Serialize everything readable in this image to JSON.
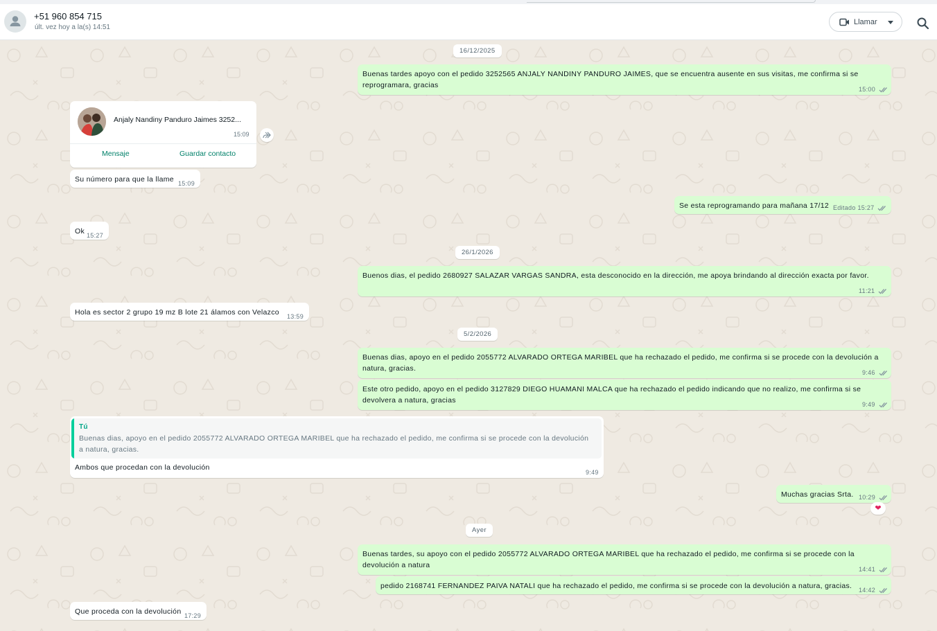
{
  "header": {
    "contact_name": "+51 960 854 715",
    "last_seen": "últ. vez hoy a la(s) 14:51",
    "call_label": "Llamar",
    "icons": [
      "person-icon",
      "video-icon",
      "chevron-down-icon",
      "search-icon"
    ]
  },
  "dates": {
    "d1": "16/12/2025",
    "d2": "26/1/2026",
    "d3": "5/2/2026",
    "d4": "Ayer"
  },
  "messages": {
    "m1": {
      "text": "Buenas tardes apoyo con el pedido 3252565 ANJALY NANDINY PANDURO JAIMES, que se encuentra ausente en sus visitas, me confirma si se reprogramara, gracias",
      "time": "15:00"
    },
    "contact_card": {
      "name": "Anjaly Nandiny Panduro Jaimes 3252...",
      "time": "15:09",
      "btn_message": "Mensaje",
      "btn_save": "Guardar contacto"
    },
    "m2": {
      "text": "Su número para que la llame",
      "time": "15:09"
    },
    "m3": {
      "text": "Se esta reprogramando para mañana 17/12",
      "edited": "Editado",
      "time": "15:27"
    },
    "m4": {
      "text": "Ok",
      "time": "15:27"
    },
    "m5": {
      "text": "Buenos dias, el pedido 2680927 SALAZAR VARGAS SANDRA, esta desconocido en la dirección, me apoya brindando al dirección exacta por favor.",
      "time": "11:21"
    },
    "m6": {
      "text": "Hola es sector 2 grupo 19 mz B lote 21 álamos con Velazco",
      "time": "13:59"
    },
    "m7": {
      "text": "Buenas dias, apoyo en el pedido 2055772 ALVARADO ORTEGA MARIBEL que ha rechazado el pedido, me confirma si se procede con la devolución a natura, gracias.",
      "time": "9:46"
    },
    "m8": {
      "text": "Este otro pedido, apoyo en el pedido 3127829 DIEGO HUAMANI MALCA que ha rechazado el pedido indicando que no realizo, me confirma si se devolvera a natura, gracias",
      "time": "9:49"
    },
    "m9": {
      "quote_author": "Tú",
      "quote_text": "Buenas dias, apoyo en el pedido 2055772 ALVARADO ORTEGA MARIBEL que ha rechazado el pedido, me confirma si se procede con la devolución a natura, gracias.",
      "text": "Ambos que procedan con la devolución",
      "time": "9:49"
    },
    "m10": {
      "text": "Muchas gracias Srta.",
      "time": "10:29",
      "reaction": "❤"
    },
    "m11": {
      "text": "Buenas tardes, su apoyo con el pedido 2055772 ALVARADO ORTEGA MARIBEL que ha rechazado el pedido, me confirma si se procede con la devolución a natura",
      "time": "14:41"
    },
    "m12": {
      "text": "pedido 2168741 FERNANDEZ  PAIVA NATALI que ha rechazado el pedido, me confirma si se procede con la devolución a natura, gracias.",
      "time": "14:42"
    },
    "m13": {
      "text": "Que proceda con la devolución",
      "time": "17:29"
    }
  },
  "colors": {
    "outgoing_bubble": "#d9fdd3",
    "incoming_bubble": "#ffffff",
    "chat_background": "#efeae2",
    "read_tick": "#53bdeb",
    "accent": "#008069"
  }
}
